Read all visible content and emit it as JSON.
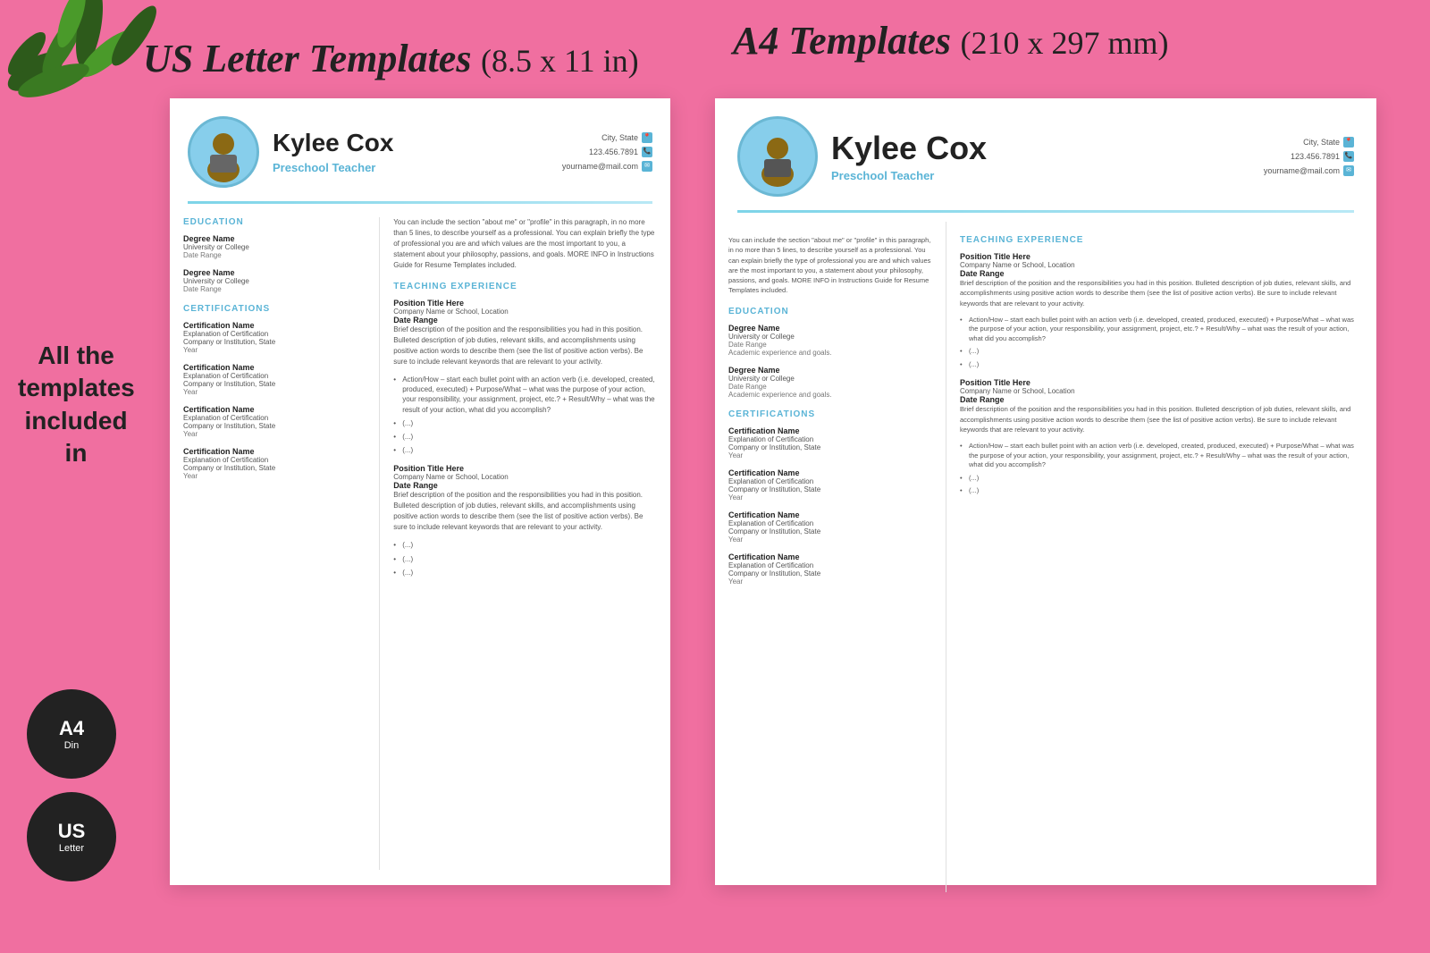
{
  "page": {
    "title_us": "US Letter Templates",
    "title_us_size": "(8.5 x 11 in)",
    "title_a4": "A4 Templates",
    "title_a4_size": "(210 x 297 mm)",
    "side_text": "All the templates included in",
    "badge_a4_main": "A4",
    "badge_a4_sub": "Din",
    "badge_us_main": "US",
    "badge_us_sub": "Letter"
  },
  "resume_us": {
    "name": "Kylee Cox",
    "title": "Preschool Teacher",
    "contact_city": "City, State",
    "contact_phone": "123.456.7891",
    "contact_email": "yourname@mail.com",
    "about": "You can include the section \"about me\" or \"profile\" in this paragraph, in no more than 5 lines, to describe yourself as a professional. You can explain briefly the type of professional you are and which values are the most important to you, a statement about your philosophy, passions, and goals. MORE INFO in Instructions Guide for Resume Templates included.",
    "education_label": "EDUCATION",
    "degree1_name": "Degree Name",
    "degree1_school": "University or College",
    "degree1_date": "Date Range",
    "degree2_name": "Degree Name",
    "degree2_school": "University or College",
    "degree2_date": "Date Range",
    "certifications_label": "CERTIFICATIONS",
    "cert1_name": "Certification Name",
    "cert1_exp": "Explanation of Certification",
    "cert1_company": "Company or Institution, State",
    "cert1_year": "Year",
    "cert2_name": "Certification Name",
    "cert2_exp": "Explanation of Certification",
    "cert2_company": "Company or Institution, State",
    "cert2_year": "Year",
    "cert3_name": "Certification Name",
    "cert3_exp": "Explanation of Certification",
    "cert3_company": "Company or Institution, State",
    "cert3_year": "Year",
    "cert4_name": "Certification Name",
    "cert4_exp": "Explanation of Certification",
    "cert4_company": "Company or Institution, State",
    "cert4_year": "Year",
    "teaching_label": "TEACHING EXPERIENCE",
    "pos1_title": "Position Title Here",
    "pos1_company": "Company Name or School, Location",
    "pos1_date": "Date Range",
    "pos1_desc": "Brief description of the position and the responsibilities you had in this position. Bulleted description of job duties, relevant skills, and accomplishments using positive action words to describe them (see the list of positive action verbs). Be sure to include relevant keywords that are relevant to your activity.",
    "pos1_bullet1": "Action/How – start each bullet point with an action verb (i.e. developed, created, produced, executed) + Purpose/What – what was the purpose of your action, your responsibility, your assignment, project, etc.? + Result/Why – what was the result of your action, what did you accomplish?",
    "pos1_bullet2": "(...)",
    "pos1_bullet3": "(...)",
    "pos1_bullet4": "(...)",
    "pos2_title": "Position Title Here",
    "pos2_company": "Company Name or School, Location",
    "pos2_date": "Date Range",
    "pos2_desc": "Brief description of the position and the responsibilities you had in this position. Bulleted description of job duties, relevant skills, and accomplishments using positive action words to describe them (see the list of positive action verbs). Be sure to include relevant keywords that are relevant to your activity.",
    "pos2_bullet1": "(...)",
    "pos2_bullet2": "(...)",
    "pos2_bullet3": "(...)"
  },
  "resume_a4": {
    "name": "Kylee Cox",
    "title": "Preschool Teacher",
    "contact_city": "City, State",
    "contact_phone": "123.456.7891",
    "contact_email": "yourname@mail.com",
    "about": "You can include the section \"about me\" or \"profile\" in this paragraph, in no more than 5 lines, to describe yourself as a professional. You can explain briefly the type of professional you are and which values are the most important to you, a statement about your philosophy, passions, and goals. MORE INFO in Instructions Guide for Resume Templates included.",
    "education_label": "EDUCATION",
    "degree1_name": "Degree Name",
    "degree1_school": "University or College",
    "degree1_date": "Date Range",
    "degree1_extra": "Academic experience and goals.",
    "degree2_name": "Degree Name",
    "degree2_school": "University or College",
    "degree2_date": "Date Range",
    "degree2_extra": "Academic experience and goals.",
    "certifications_label": "CERTIFICATIONS",
    "cert1_name": "Certification Name",
    "cert1_exp": "Explanation of Certification",
    "cert1_company": "Company or Institution, State",
    "cert1_year": "Year",
    "cert2_name": "Certification Name",
    "cert2_exp": "Explanation of Certification",
    "cert2_company": "Company or Institution, State",
    "cert2_year": "Year",
    "cert3_name": "Certification Name",
    "cert3_exp": "Explanation of Certification",
    "cert3_company": "Company or Institution, State",
    "cert3_year": "Year",
    "cert4_name": "Certification Name",
    "cert4_exp": "Explanation of Certification",
    "cert4_company": "Company or Institution, State",
    "cert4_year": "Year",
    "teaching_label": "TEACHING EXPERIENCE",
    "pos1_title": "Position Title Here",
    "pos1_company": "Company Name or School, Location",
    "pos1_date": "Date Range",
    "pos1_desc": "Brief description of the position and the responsibilities you had in this position. Bulleted description of job duties, relevant skills, and accomplishments using positive action words to describe them (see the list of positive action verbs). Be sure to include relevant keywords that are relevant to your activity.",
    "pos1_bullet1": "Action/How – start each bullet point with an action verb (i.e. developed, created, produced, executed) + Purpose/What – what was the purpose of your action, your responsibility, your assignment, project, etc.? + Result/Why – what was the result of your action, what did you accomplish?",
    "pos1_bullet2": "(...)",
    "pos1_bullet3": "(...)",
    "pos2_title": "Position Title Here",
    "pos2_company": "Company Name or School, Location",
    "pos2_date": "Date Range",
    "pos2_desc": "Brief description of the position and the responsibilities you had in this position. Bulleted description of job duties, relevant skills, and accomplishments using positive action words to describe them (see the list of positive action verbs). Be sure to include relevant keywords that are relevant to your activity.",
    "pos2_bullet1": "Action/How – start each bullet point with an action verb (i.e. developed, created, produced, executed) + Purpose/What – what was the purpose of your action, your responsibility, your assignment, project, etc.? + Result/Why – what was the result of your action, what did you accomplish?",
    "pos2_bullet2": "(...)",
    "pos2_bullet3": "(...)"
  }
}
